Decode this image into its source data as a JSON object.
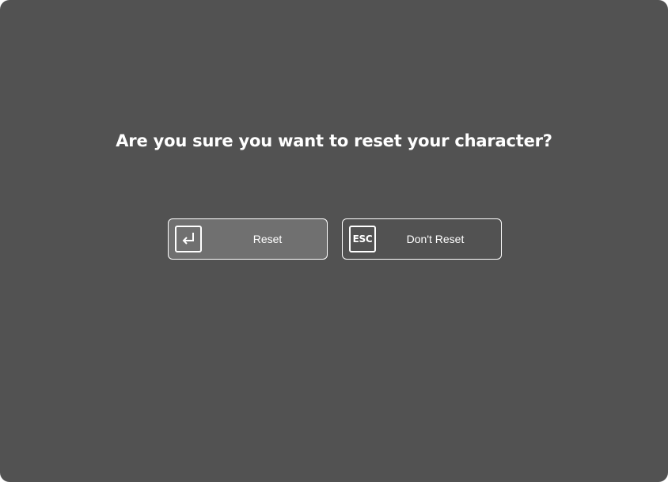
{
  "dialog": {
    "question": "Are you sure you want to reset your character?",
    "confirm_button": {
      "label": "Reset",
      "key_icon": "enter-key-icon"
    },
    "cancel_button": {
      "label": "Don't Reset",
      "key_icon": "esc-key-icon",
      "key_text": "ESC"
    }
  },
  "colors": {
    "background": "#525252",
    "confirm_button_fill": "#707070",
    "text": "#ffffff",
    "border": "#ffffff"
  }
}
